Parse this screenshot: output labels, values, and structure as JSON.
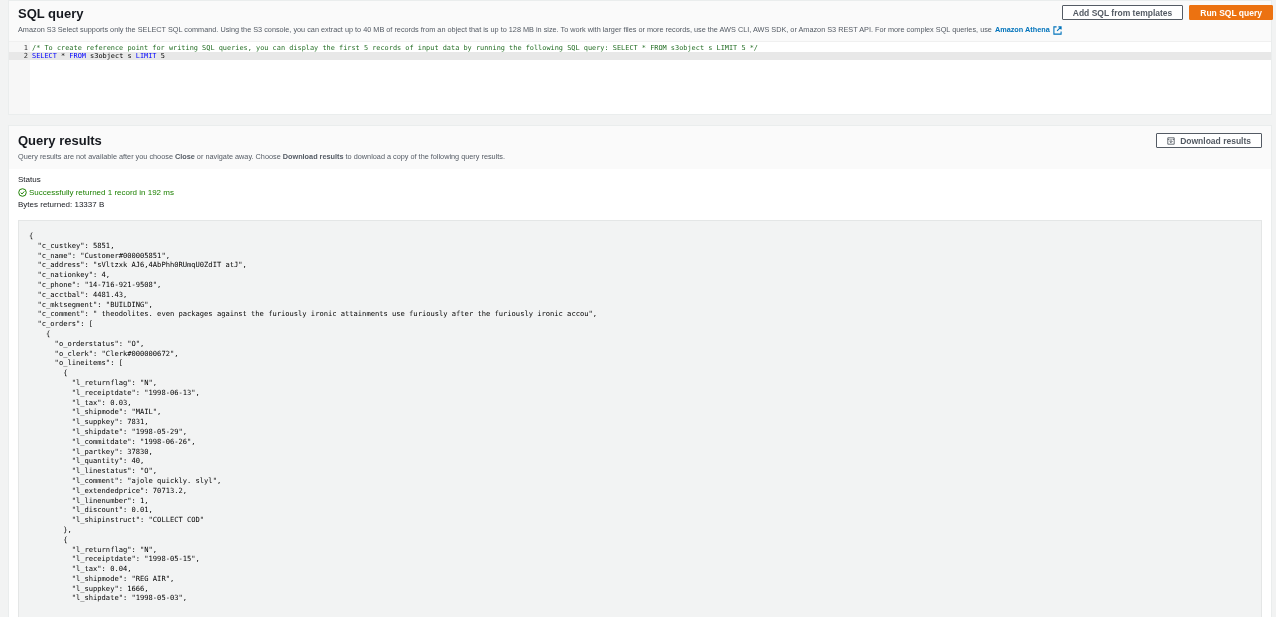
{
  "sql_query": {
    "title": "SQL query",
    "description": "Amazon S3 Select supports only the SELECT SQL command. Using the S3 console, you can extract up to 40 MB of records from an object that is up to 128 MB in size. To work with larger files or more records, use the AWS CLI, AWS SDK, or Amazon S3 REST API. For more complex SQL queries, use",
    "link": "Amazon Athena",
    "buttons": [
      {
        "label": "Add SQL from templates",
        "kind": "secondary"
      },
      {
        "label": "Run SQL query",
        "kind": "primary"
      }
    ],
    "editor": {
      "lines": [
        {
          "number": "1",
          "highlighted": false,
          "tokens": [
            {
              "kind": "comment",
              "text": "/* To create reference point for writing SQL queries, you can display the first 5 records of input data by running the following SQL query: SELECT * FROM s3object s LIMIT 5 */"
            }
          ]
        },
        {
          "number": "2",
          "highlighted": true,
          "tokens": [
            {
              "kind": "keyword",
              "text": "SELECT"
            },
            {
              "kind": "plain",
              "text": " * "
            },
            {
              "kind": "keyword",
              "text": "FROM"
            },
            {
              "kind": "plain",
              "text": " s3object s "
            },
            {
              "kind": "keyword",
              "text": "LIMIT"
            },
            {
              "kind": "plain",
              "text": " 5"
            }
          ]
        }
      ]
    }
  },
  "query_results": {
    "title": "Query results",
    "description": "Query results are not available after you choose **Close** or navigate away. Choose **Download results** to download a copy of the following query results.",
    "download_button": "Download results",
    "status_label": "Status",
    "status": "Successfully returned 1 record in 192 ms",
    "bytes": "Bytes returned: 13337 B",
    "output": [
      "{",
      "  \"c_custkey\": 5851,",
      "  \"c_name\": \"Customer#000005851\",",
      "  \"c_address\": \"sVltzxk AJ6,4AbPhh0RUmqU0ZdIT atJ\",",
      "  \"c_nationkey\": 4,",
      "  \"c_phone\": \"14-716-921-9508\",",
      "  \"c_acctbal\": 4481.43,",
      "  \"c_mktsegment\": \"BUILDING\",",
      "  \"c_comment\": \" theodolites. even packages against the furiously ironic attainments use furiously after the furiously ironic accou\",",
      "  \"c_orders\": [",
      "    {",
      "      \"o_orderstatus\": \"O\",",
      "      \"o_clerk\": \"Clerk#000000672\",",
      "      \"o_lineitems\": [",
      "        {",
      "          \"l_returnflag\": \"N\",",
      "          \"l_receiptdate\": \"1998-06-13\",",
      "          \"l_tax\": 0.03,",
      "          \"l_shipmode\": \"MAIL\",",
      "          \"l_suppkey\": 7831,",
      "          \"l_shipdate\": \"1998-05-29\",",
      "          \"l_commitdate\": \"1998-06-26\",",
      "          \"l_partkey\": 37830,",
      "          \"l_quantity\": 40,",
      "          \"l_linestatus\": \"O\",",
      "          \"l_comment\": \"ajole quickly. slyl\",",
      "          \"l_extendedprice\": 70713.2,",
      "          \"l_linenumber\": 1,",
      "          \"l_discount\": 0.01,",
      "          \"l_shipinstruct\": \"COLLECT COD\"",
      "        },",
      "        {",
      "          \"l_returnflag\": \"N\",",
      "          \"l_receiptdate\": \"1998-05-15\",",
      "          \"l_tax\": 0.04,",
      "          \"l_shipmode\": \"REG AIR\",",
      "          \"l_suppkey\": 1666,",
      "          \"l_shipdate\": \"1998-05-03\","
    ]
  }
}
